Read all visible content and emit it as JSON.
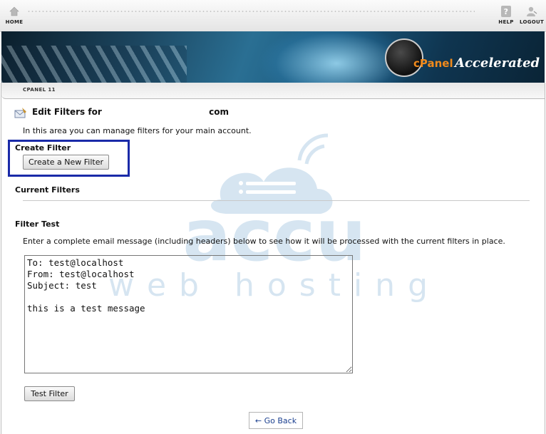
{
  "nav": {
    "home_label": "HOME",
    "help_label": "HELP",
    "logout_label": "LOGOUT"
  },
  "banner": {
    "logo_cpanel": "cPanel",
    "logo_accelerated": "Accelerated"
  },
  "breadcrumb": {
    "label": "CPANEL 11"
  },
  "page": {
    "title_prefix": "Edit Filters for",
    "title_suffix": "com",
    "intro": "In this area you can manage filters for your main account."
  },
  "create_filter": {
    "heading": "Create Filter",
    "button_label": "Create a New Filter"
  },
  "current_filters": {
    "heading": "Current Filters"
  },
  "filter_test": {
    "heading": "Filter Test",
    "description": "Enter a complete email message (including headers) below to see how it will be processed with the current filters in place.",
    "message_value": "To: test@localhost\nFrom: test@localhost\nSubject: test\n\nthis is a test message",
    "button_label": "Test Filter"
  },
  "go_back": {
    "label": "← Go Back"
  },
  "watermark": {
    "line1": "accu",
    "line2": "web hosting"
  },
  "colors": {
    "highlight_border": "#1a2aa8",
    "link": "#1a3f8f",
    "watermark": "#cfe0ee"
  }
}
